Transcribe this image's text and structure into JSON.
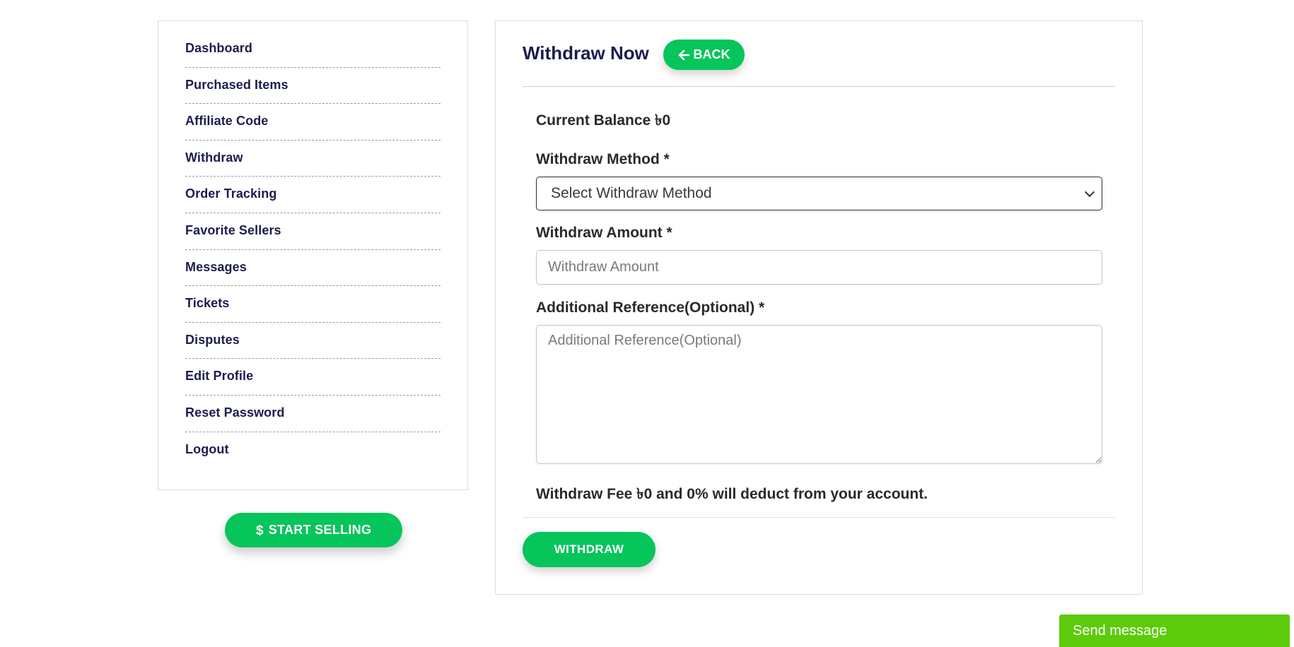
{
  "sidebar": {
    "items": [
      {
        "label": "Dashboard"
      },
      {
        "label": "Purchased Items"
      },
      {
        "label": "Affiliate Code"
      },
      {
        "label": "Withdraw"
      },
      {
        "label": "Order Tracking"
      },
      {
        "label": "Favorite Sellers"
      },
      {
        "label": "Messages"
      },
      {
        "label": "Tickets"
      },
      {
        "label": "Disputes"
      },
      {
        "label": "Edit Profile"
      },
      {
        "label": "Reset Password"
      },
      {
        "label": "Logout"
      }
    ],
    "start_selling_label": "START SELLING",
    "start_selling_icon": "dollar-icon"
  },
  "main": {
    "title": "Withdraw Now",
    "back_label": "BACK",
    "back_icon": "arrow-left-icon",
    "current_balance": "Current Balance ৳0",
    "method_label": "Withdraw Method *",
    "method_selected": "Select Withdraw Method",
    "amount_label": "Withdraw Amount *",
    "amount_placeholder": "Withdraw Amount",
    "reference_label": "Additional Reference(Optional) *",
    "reference_placeholder": "Additional Reference(Optional)",
    "fee_text": "Withdraw Fee ৳0 and 0% will deduct from your account.",
    "withdraw_label": "WITHDRAW"
  },
  "chat_widget": {
    "label": "Send message"
  },
  "colors": {
    "accent": "#06c55a",
    "chat": "#5ccb0c",
    "nav_text": "#1c1d4f"
  }
}
